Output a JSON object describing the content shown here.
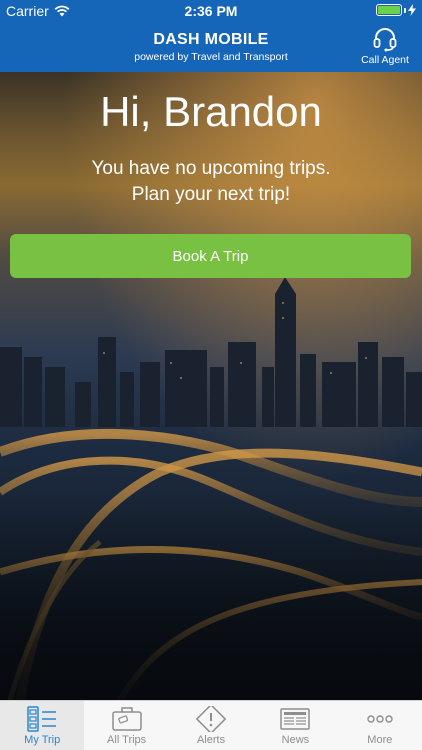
{
  "status_bar": {
    "carrier": "Carrier",
    "time": "2:36 PM"
  },
  "nav": {
    "title": "DASH MOBILE",
    "subtitle": "powered by Travel and Transport",
    "call_agent_label": "Call Agent"
  },
  "hero": {
    "greeting": "Hi, Brandon",
    "message_line1": "You have no upcoming trips.",
    "message_line2": "Plan your next trip!",
    "book_button_label": "Book A Trip"
  },
  "tabs": [
    {
      "label": "My Trip",
      "icon": "my-trip-icon",
      "active": true
    },
    {
      "label": "All Trips",
      "icon": "suitcase-icon",
      "active": false
    },
    {
      "label": "Alerts",
      "icon": "alert-icon",
      "active": false
    },
    {
      "label": "News",
      "icon": "newspaper-icon",
      "active": false
    },
    {
      "label": "More",
      "icon": "more-dots-icon",
      "active": false
    }
  ],
  "colors": {
    "brand": "#1565b8",
    "button": "#79c142",
    "active_tab": "#2a85cf"
  }
}
